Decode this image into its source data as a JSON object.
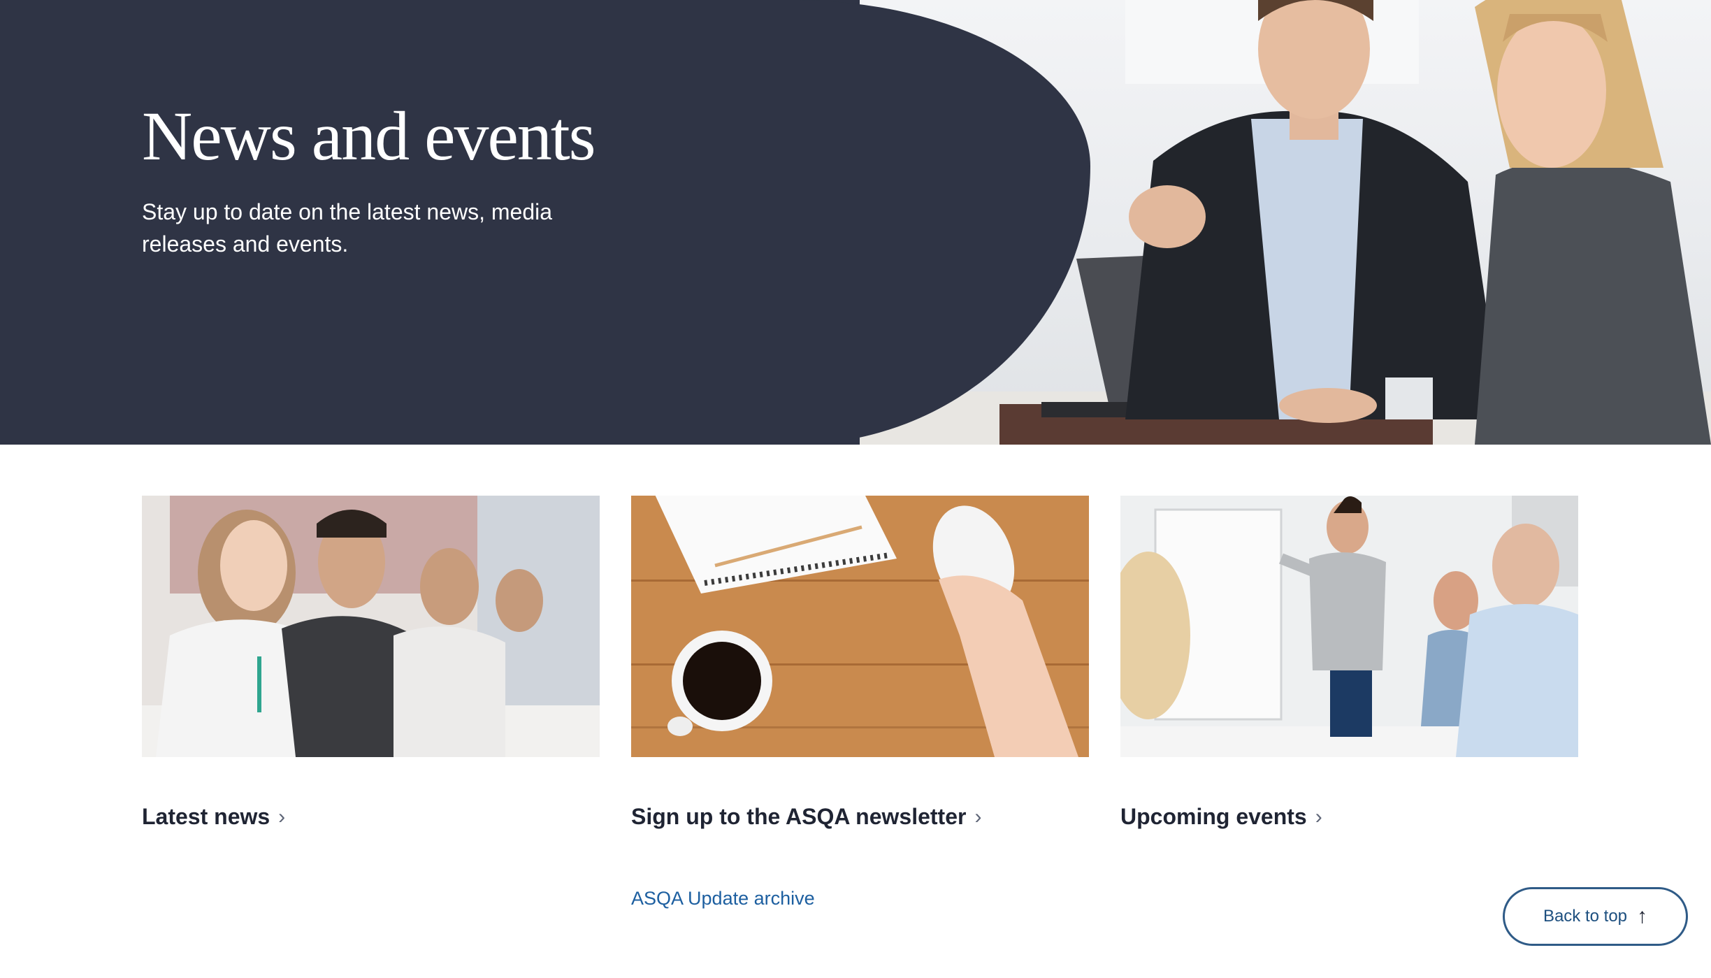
{
  "hero": {
    "title": "News and events",
    "subtitle": "Stay up to date on the latest news, media releases and events."
  },
  "cards": [
    {
      "label": "Latest news",
      "chevron": "›",
      "image": "students-writing-photo"
    },
    {
      "label": "Sign up to the ASQA newsletter",
      "chevron": "›",
      "image": "desk-notebook-coffee-photo"
    },
    {
      "label": "Upcoming events",
      "chevron": "›",
      "image": "presenter-flipchart-photo"
    }
  ],
  "archive": {
    "label": "ASQA Update archive"
  },
  "back_to_top": {
    "label": "Back to top",
    "icon": "arrow-up-icon",
    "glyph": "↑"
  },
  "colors": {
    "hero_bg": "#2f3445",
    "link_blue": "#1d5fa0",
    "heading": "#1f2433"
  }
}
